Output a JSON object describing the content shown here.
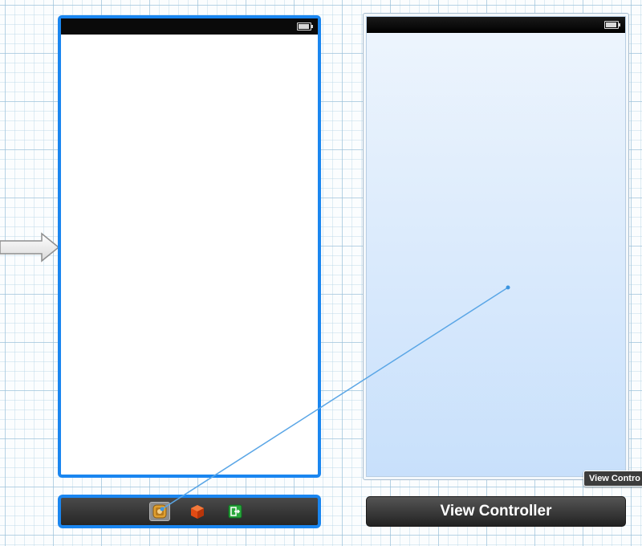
{
  "canvas": {
    "background": "#fbfdfe",
    "grid_color": "#96bed7"
  },
  "accent": "#1a86f0",
  "initial_arrow": {
    "icon": "initial-scene-arrow-icon"
  },
  "scenes": [
    {
      "id": "left",
      "selected": true,
      "view_background": "#ffffff",
      "status_bar": {
        "icon": "battery-icon"
      },
      "dock": {
        "icons": [
          "first-responder-icon",
          "cube-icon",
          "exit-icon"
        ]
      }
    },
    {
      "id": "right",
      "selected": false,
      "view_background": "gradient #eef5fd to #c8e0fb",
      "status_bar": {
        "icon": "battery-icon"
      },
      "title": "View Controller",
      "tooltip": "View Contro"
    }
  ],
  "connection": {
    "color": "#5aa6e6",
    "kind": "drag-connection-line"
  }
}
